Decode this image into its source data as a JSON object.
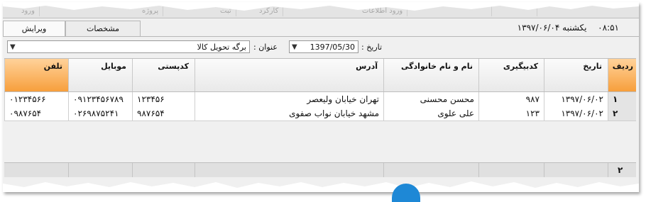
{
  "topbar": {
    "items": [
      "ورود",
      "پروژه",
      "ثبت",
      "کارکرد",
      "ورود اطلاعات"
    ]
  },
  "tabs": [
    {
      "label": "ویرایش"
    },
    {
      "label": "مشخصات"
    }
  ],
  "header": {
    "time": "۰۸:۵۱",
    "day": "یکشنبه",
    "date": "۱۳۹۷/۰۶/۰۴"
  },
  "form": {
    "date_label": "تاریخ :",
    "date_value": "1397/05/30",
    "title_label": "عنوان :",
    "title_value": "برگه تحویل کالا"
  },
  "grid": {
    "columns": [
      "ردیف",
      "تاریخ",
      "کدبیگیری",
      "نام و نام خانوادگی",
      "آدرس",
      "کدپستی",
      "موبایل",
      "تلفن"
    ],
    "rows": [
      {
        "num": "۱",
        "date": "۱۳۹۷/۰۶/۰۲",
        "code": "۹۸۷",
        "name": "محسن محسنی",
        "address": "تهران خیابان ولیعصر",
        "postal": "۱۲۳۴۵۶",
        "mobile": "۰۹۱۲۳۴۵۶۷۸۹",
        "phone": "۰۱۲۳۴۵۶۶"
      },
      {
        "num": "۲",
        "date": "۱۳۹۷/۰۶/۰۲",
        "code": "۱۲۳",
        "name": "علی علوی",
        "address": "مشهد خیابان نواب صفوی",
        "postal": "۹۸۷۶۵۴",
        "mobile": "۰۲۶۹۸۷۵۲۴۱",
        "phone": "۰۹۸۷۶۵۴"
      }
    ],
    "row_count": "۲"
  },
  "colors": {
    "accent_header": "#f79f3c",
    "accent_blue": "#1e88d6"
  }
}
